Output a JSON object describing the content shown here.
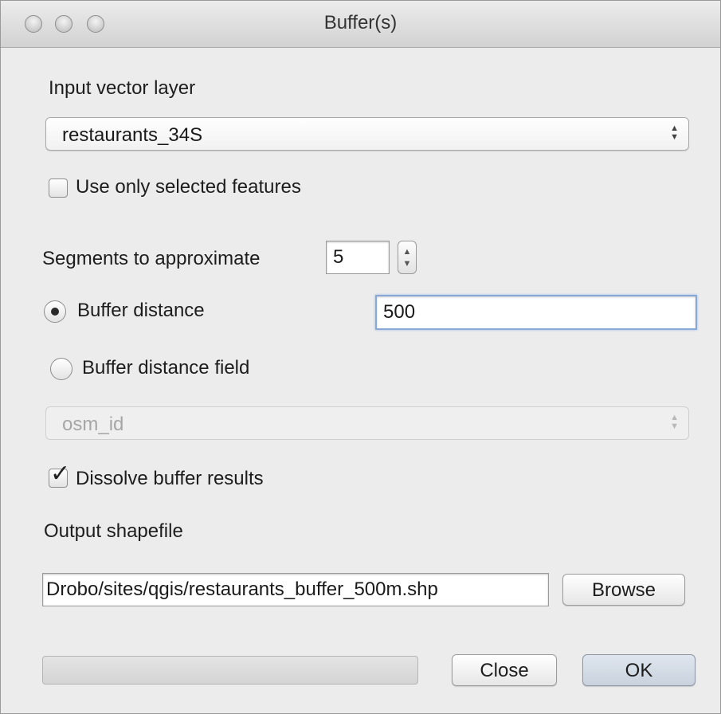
{
  "window": {
    "title": "Buffer(s)"
  },
  "input_layer": {
    "label": "Input vector layer",
    "selected": "restaurants_34S"
  },
  "use_selected": {
    "label": "Use only selected features",
    "checked": false
  },
  "segments": {
    "label": "Segments to approximate",
    "value": "5"
  },
  "buffer_distance": {
    "label": "Buffer distance",
    "selected": true,
    "value": "500"
  },
  "buffer_distance_field": {
    "label": "Buffer distance field",
    "selected": false,
    "field": "osm_id"
  },
  "dissolve": {
    "label": "Dissolve buffer results",
    "checked": true
  },
  "output": {
    "label": "Output shapefile",
    "path": "Drobo/sites/qgis/restaurants_buffer_500m.shp",
    "browse_label": "Browse"
  },
  "footer": {
    "close_label": "Close",
    "ok_label": "OK",
    "progress": 0
  }
}
